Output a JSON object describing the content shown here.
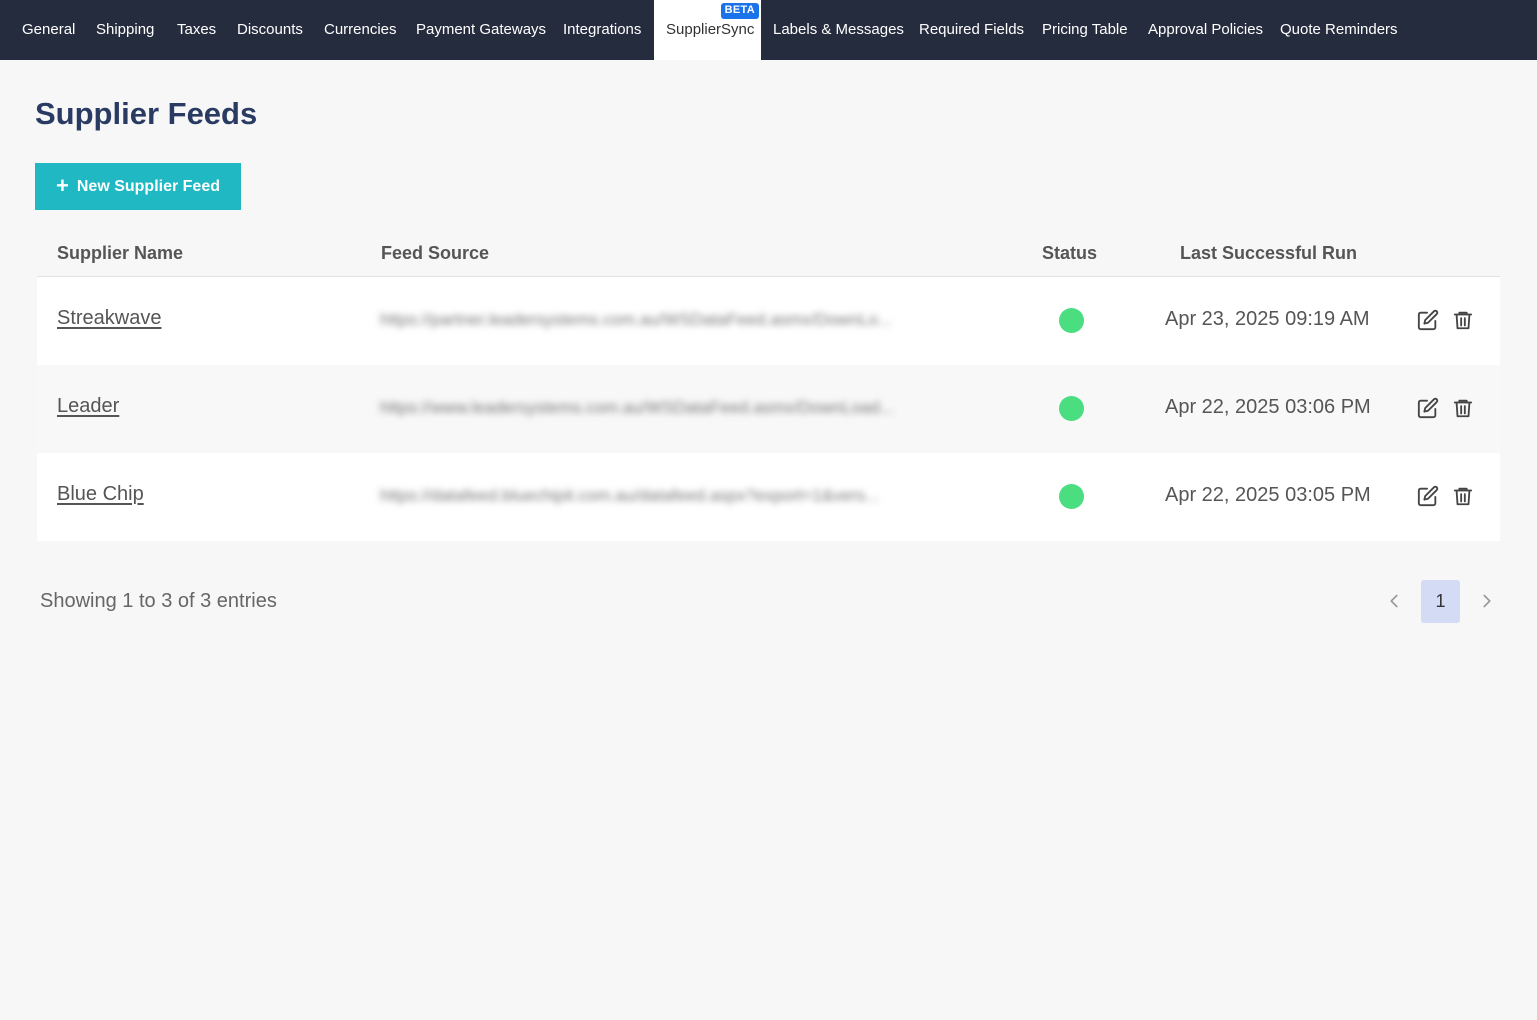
{
  "nav": {
    "tabs": [
      {
        "label": "General"
      },
      {
        "label": "Shipping"
      },
      {
        "label": "Taxes"
      },
      {
        "label": "Discounts"
      },
      {
        "label": "Currencies"
      },
      {
        "label": "Payment Gateways"
      },
      {
        "label": "Integrations"
      },
      {
        "label": "SupplierSync",
        "badge": "BETA",
        "active": true
      },
      {
        "label": "Labels & Messages"
      },
      {
        "label": "Required Fields"
      },
      {
        "label": "Pricing Table"
      },
      {
        "label": "Approval Policies"
      },
      {
        "label": "Quote Reminders"
      }
    ]
  },
  "page": {
    "title": "Supplier Feeds",
    "new_button_label": "New Supplier Feed",
    "new_button_icon": "plus-icon"
  },
  "table": {
    "columns": [
      "Supplier Name",
      "Feed Source",
      "Status",
      "Last Successful Run"
    ],
    "rows": [
      {
        "name": "Streakwave",
        "feed_source": "https://partner.leadersystems.com.au/WSDataFeed.asmx/DownLo...",
        "status": "active",
        "last_run": "Apr 23, 2025 09:19 AM"
      },
      {
        "name": "Leader",
        "feed_source": "https://www.leadersystems.com.au/WSDataFeed.asmx/DownLoad...",
        "status": "active",
        "last_run": "Apr 22, 2025 03:06 PM"
      },
      {
        "name": "Blue Chip",
        "feed_source": "https://datafeed.bluechipit.com.au/datafeed.aspx?export=1&vers...",
        "status": "active",
        "last_run": "Apr 22, 2025 03:05 PM"
      }
    ]
  },
  "footer": {
    "showing_text": "Showing 1 to 3 of 3 entries",
    "current_page": "1"
  },
  "colors": {
    "nav_bg": "#252c3e",
    "title": "#2a3b63",
    "primary_button": "#1fb8c3",
    "status_active": "#4ade80",
    "beta_badge": "#1a73e8",
    "page_active_bg": "#d3dbf5"
  }
}
